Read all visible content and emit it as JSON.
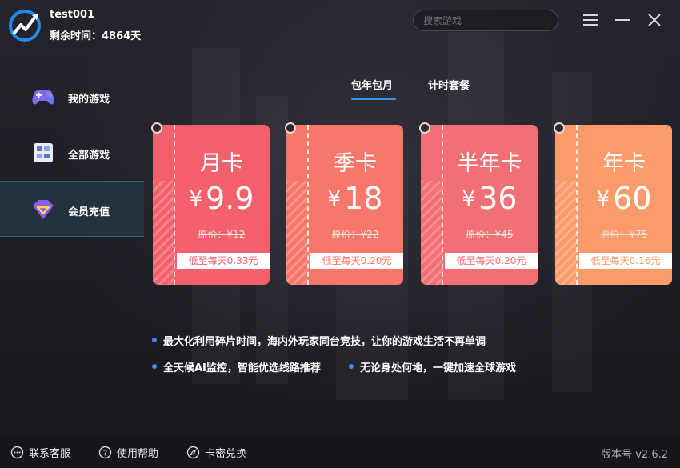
{
  "user": {
    "name": "test001",
    "remaining": "剩余时间：4864天"
  },
  "search": {
    "placeholder": "搜索游戏"
  },
  "sidebar": {
    "items": [
      {
        "label": "我的游戏",
        "icon": "gamepad-icon"
      },
      {
        "label": "全部游戏",
        "icon": "game-list-icon"
      },
      {
        "label": "会员充值",
        "icon": "diamond-icon",
        "active": true
      }
    ]
  },
  "tabs": [
    {
      "label": "包年包月",
      "active": true
    },
    {
      "label": "计时套餐"
    }
  ],
  "cards": [
    {
      "title": "月卡",
      "currency": "¥",
      "price": "9.9",
      "original": "原价：¥12",
      "daily": "低至每天0.33元",
      "color": "#f4616d"
    },
    {
      "title": "季卡",
      "currency": "¥",
      "price": "18",
      "original": "原价：¥22",
      "daily": "低至每天0.20元",
      "color": "#f7776a"
    },
    {
      "title": "半年卡",
      "currency": "¥",
      "price": "36",
      "original": "原价：¥45",
      "daily": "低至每天0.20元",
      "color": "#f26f75"
    },
    {
      "title": "年卡",
      "currency": "¥",
      "price": "60",
      "original": "原价：¥75",
      "daily": "低至每天0.16元",
      "color": "#fb9b6c"
    }
  ],
  "features": [
    "最大化利用碎片时间，海内外玩家同台竞技，让你的游戏生活不再单调",
    "全天候AI监控，智能优选线路推荐",
    "无论身处何地，一键加速全球游戏"
  ],
  "footer": {
    "support": "联系客服",
    "help": "使用帮助",
    "redeem": "卡密兑换",
    "version": "版本号 v2.6.2"
  },
  "colors": {
    "accent": "#3b8ff0",
    "active_nav": "#24323d"
  }
}
